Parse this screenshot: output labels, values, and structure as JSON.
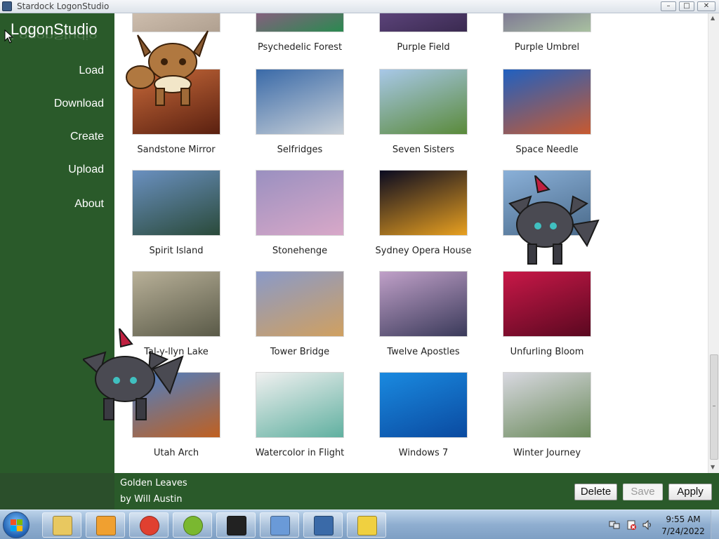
{
  "window": {
    "title": "Stardock LogonStudio"
  },
  "sidebar": {
    "logo": "LogonStudio",
    "items": [
      {
        "label": "Load"
      },
      {
        "label": "Download"
      },
      {
        "label": "Create"
      },
      {
        "label": "Upload"
      },
      {
        "label": "About"
      }
    ]
  },
  "gallery": {
    "tiles": [
      {
        "label": "",
        "colors": [
          "#e8d8c8",
          "#b0a090"
        ]
      },
      {
        "label": "Psychedelic Forest",
        "colors": [
          "#d838a8",
          "#2a8a50"
        ]
      },
      {
        "label": "Purple Field",
        "colors": [
          "#7a5aa0",
          "#3a2a50"
        ]
      },
      {
        "label": "Purple Umbrel",
        "colors": [
          "#5a3a8a",
          "#a8c0a0"
        ]
      },
      {
        "label": "Sandstone Mirror",
        "colors": [
          "#c86a3a",
          "#5a2010"
        ]
      },
      {
        "label": "Selfridges",
        "colors": [
          "#3a6aa8",
          "#c8d0d8"
        ]
      },
      {
        "label": "Seven Sisters",
        "colors": [
          "#a8c8e8",
          "#5a8a3a"
        ]
      },
      {
        "label": "Space Needle",
        "colors": [
          "#2060c0",
          "#c85a30"
        ]
      },
      {
        "label": "Spirit Island",
        "colors": [
          "#6a90c0",
          "#2a4a3a"
        ]
      },
      {
        "label": "Stonehenge",
        "colors": [
          "#9a90c0",
          "#d8a8c8"
        ]
      },
      {
        "label": "Sydney Opera House",
        "colors": [
          "#0a0a20",
          "#e8a020"
        ]
      },
      {
        "label": "",
        "colors": [
          "#8ab0d8",
          "#4a6a8a"
        ]
      },
      {
        "label": "Tal-y-llyn Lake",
        "colors": [
          "#b8b098",
          "#5a5a48"
        ]
      },
      {
        "label": "Tower Bridge",
        "colors": [
          "#8a9ac8",
          "#d0a060"
        ]
      },
      {
        "label": "Twelve Apostles",
        "colors": [
          "#c0a0c8",
          "#3a3a5a"
        ]
      },
      {
        "label": "Unfurling Bloom",
        "colors": [
          "#c81848",
          "#5a0820"
        ]
      },
      {
        "label": "Utah Arch",
        "colors": [
          "#4a80c8",
          "#c06020"
        ]
      },
      {
        "label": "Watercolor in Flight",
        "colors": [
          "#f0f0f0",
          "#60b0a0"
        ]
      },
      {
        "label": "Windows 7",
        "colors": [
          "#1a8ae0",
          "#0a4aa0"
        ]
      },
      {
        "label": "Winter Journey",
        "colors": [
          "#d8d8e0",
          "#6a8a5a"
        ]
      }
    ]
  },
  "selected_theme": {
    "name": "Golden Leaves",
    "author": "by Will Austin"
  },
  "actions": {
    "delete_label": "Delete",
    "save_label": "Save",
    "apply_label": "Apply"
  },
  "taskbar": {
    "apps": [
      {
        "icon": "folder-icon"
      },
      {
        "icon": "media-player-icon"
      },
      {
        "icon": "chrome-icon"
      },
      {
        "icon": "app-green-icon"
      },
      {
        "icon": "7zip-icon"
      },
      {
        "icon": "control-panel-icon"
      },
      {
        "icon": "logonstudio-icon"
      },
      {
        "icon": "help-icon"
      }
    ],
    "time": "9:55 AM",
    "date": "7/24/2022"
  }
}
